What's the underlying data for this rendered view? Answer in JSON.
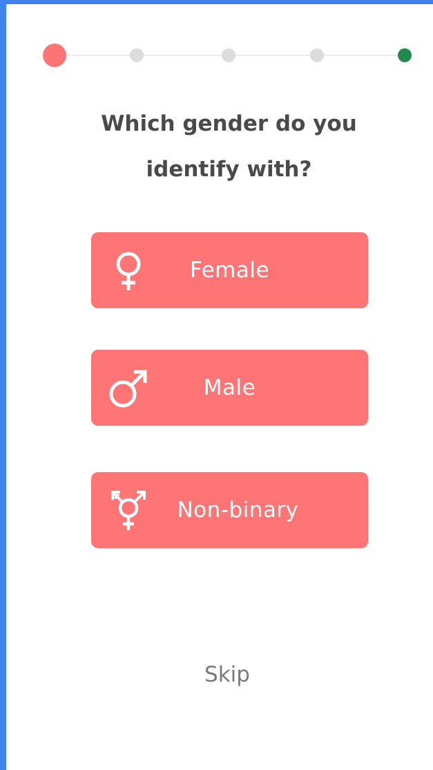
{
  "colors": {
    "accent": "#ff7575",
    "progress_complete": "#1f8a4c",
    "progress_current": "#ff7575",
    "progress_pending": "#dcdcdc",
    "frame": "#3f82f0",
    "text": "#4a4a4a",
    "muted_text": "#7a7a7a"
  },
  "progress": {
    "total_steps": 5,
    "steps": [
      {
        "state": "current"
      },
      {
        "state": "pending"
      },
      {
        "state": "pending"
      },
      {
        "state": "pending"
      },
      {
        "state": "complete"
      }
    ]
  },
  "question": {
    "title": "Which gender do you identify with?"
  },
  "options": [
    {
      "label": "Female",
      "icon": "female-symbol-icon"
    },
    {
      "label": "Male",
      "icon": "male-symbol-icon"
    },
    {
      "label": "Non-binary",
      "icon": "transgender-symbol-icon"
    }
  ],
  "skip": {
    "label": "Skip"
  }
}
